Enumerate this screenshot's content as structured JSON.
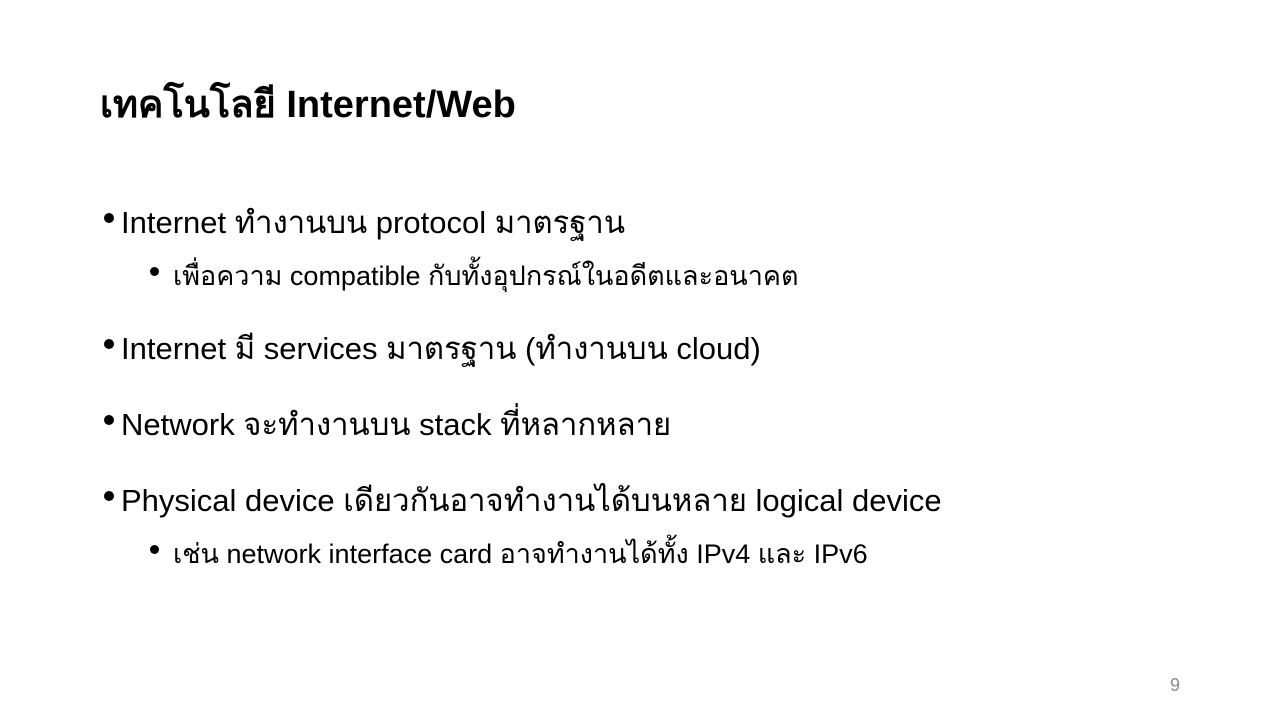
{
  "slide": {
    "title": "เทคโนโลยี Internet/Web",
    "bullets": [
      "Internet ทำงานบน protocol มาตรฐาน",
      "เพื่อความ compatible กับทั้งอุปกรณ์ในอดีตและอนาคต",
      "Internet มี services มาตรฐาน (ทำงานบน cloud)",
      "Network จะทำงานบน stack ที่หลากหลาย",
      "Physical device เดียวกันอาจทำงานได้บนหลาย logical device",
      "เช่น network interface card อาจทำงานได้ทั้ง IPv4 และ IPv6"
    ],
    "page_number": "9"
  }
}
